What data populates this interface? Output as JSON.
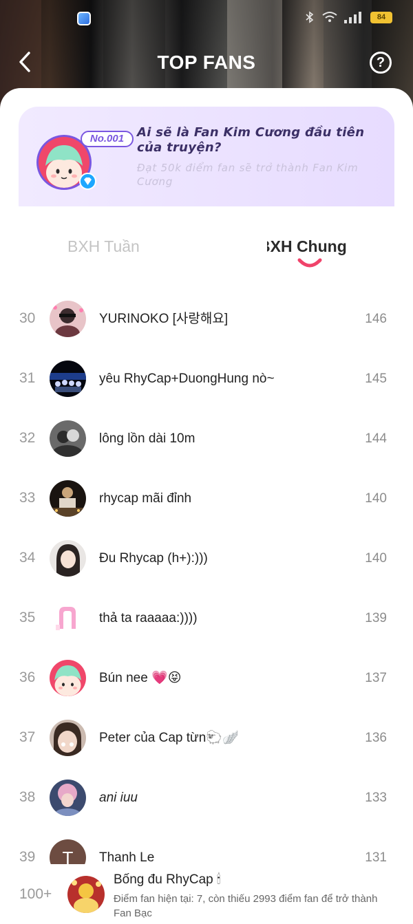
{
  "status_bar": {
    "battery": "84"
  },
  "header": {
    "title": "TOP FANS",
    "help_label": "?"
  },
  "banner": {
    "badge": "No.001",
    "title": "Ai sẽ là Fan Kim Cương đầu tiên của truyện?",
    "subtitle": "Đạt 50k điểm fan sẽ trở thành Fan Kim Cương"
  },
  "tabs": [
    {
      "label": "BXH Tuần",
      "active": false
    },
    {
      "label": "BXH Chung",
      "active": true
    }
  ],
  "fans": [
    {
      "rank": "30",
      "name": "YURINOKO [사랑해요]",
      "score": "146",
      "avatar": "photo-pink",
      "italic": false
    },
    {
      "rank": "31",
      "name": "yêu RhyCap+DuongHung nò~",
      "score": "145",
      "avatar": "photo-stage",
      "italic": false
    },
    {
      "rank": "32",
      "name": "lông lồn dài 10m",
      "score": "144",
      "avatar": "photo-gray",
      "italic": false
    },
    {
      "rank": "33",
      "name": "rhycap mãi đỉnh",
      "score": "140",
      "avatar": "photo-dark",
      "italic": false
    },
    {
      "rank": "34",
      "name": "Đu Rhycap (h+):)))",
      "score": "140",
      "avatar": "photo-girl",
      "italic": false
    },
    {
      "rank": "35",
      "name": "thả ta raaaaa:))))",
      "score": "139",
      "avatar": "letter-n",
      "italic": false
    },
    {
      "rank": "36",
      "name": "Bún nee 💗😝",
      "score": "137",
      "avatar": "default-mascot",
      "italic": false
    },
    {
      "rank": "37",
      "name": "Peter của Cap từn🐑🪽",
      "score": "136",
      "avatar": "photo-face",
      "italic": false
    },
    {
      "rank": "38",
      "name": "ani iuu",
      "score": "133",
      "avatar": "photo-pink-hair",
      "italic": true
    },
    {
      "rank": "39",
      "name": "Thanh Le",
      "score": "131",
      "avatar": "letter-t",
      "italic": false
    }
  ],
  "self": {
    "rank": "100+",
    "name": "Bống đu RhyCap 🕯",
    "description": "Điểm fan hiện tại: 7, còn thiếu 2993 điểm fan để trở thành Fan Bạc"
  },
  "colors": {
    "accent": "#7a57e0",
    "tab_indicator": "#f0436a",
    "banner_bg": "#ece3ff"
  }
}
